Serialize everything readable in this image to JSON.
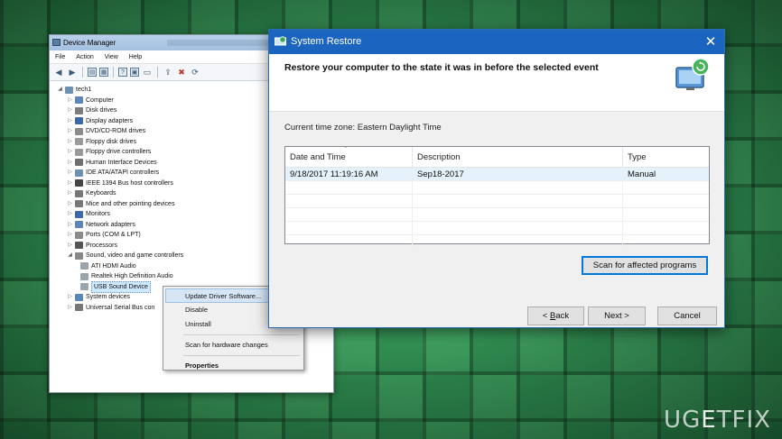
{
  "device_manager": {
    "title": "Device Manager",
    "menu": [
      "File",
      "Action",
      "View",
      "Help"
    ],
    "tree": {
      "root": "tech1",
      "categories": [
        {
          "label": "Computer",
          "expanded": false,
          "color": "#5b86b8"
        },
        {
          "label": "Disk drives",
          "expanded": false,
          "color": "#7d7d7d"
        },
        {
          "label": "Display adapters",
          "expanded": false,
          "color": "#3d6aa6"
        },
        {
          "label": "DVD/CD-ROM drives",
          "expanded": false,
          "color": "#8b8b8b"
        },
        {
          "label": "Floppy disk drives",
          "expanded": false,
          "color": "#9a9a9a"
        },
        {
          "label": "Floppy drive controllers",
          "expanded": false,
          "color": "#9a9a9a"
        },
        {
          "label": "Human Interface Devices",
          "expanded": false,
          "color": "#6f6f6f"
        },
        {
          "label": "IDE ATA/ATAPI controllers",
          "expanded": false,
          "color": "#6f8fb0"
        },
        {
          "label": "IEEE 1394 Bus host controllers",
          "expanded": false,
          "color": "#444"
        },
        {
          "label": "Keyboards",
          "expanded": false,
          "color": "#777"
        },
        {
          "label": "Mice and other pointing devices",
          "expanded": false,
          "color": "#777"
        },
        {
          "label": "Monitors",
          "expanded": false,
          "color": "#3d6aa6"
        },
        {
          "label": "Network adapters",
          "expanded": false,
          "color": "#5b86b8"
        },
        {
          "label": "Ports (COM & LPT)",
          "expanded": false,
          "color": "#8a8a8a"
        },
        {
          "label": "Processors",
          "expanded": false,
          "color": "#555"
        },
        {
          "label": "Sound, video and game controllers",
          "expanded": true,
          "color": "#888",
          "children": [
            "ATI HDMI Audio",
            "Realtek High Definition Audio",
            "USB Sound Device"
          ]
        },
        {
          "label": "System devices",
          "expanded": false,
          "color": "#5b86b8"
        },
        {
          "label": "Universal Serial Bus con",
          "expanded": false,
          "color": "#777"
        }
      ]
    },
    "context_menu": {
      "items": [
        "Update Driver Software...",
        "Disable",
        "Uninstall"
      ],
      "scan": "Scan for hardware changes",
      "properties": "Properties"
    }
  },
  "system_restore": {
    "title": "System Restore",
    "close": "✕",
    "heading": "Restore your computer to the state it was in before the selected event",
    "timezone": "Current time zone: Eastern Daylight Time",
    "columns": [
      "Date and Time",
      "Description",
      "Type"
    ],
    "rows": [
      {
        "date": "9/18/2017 11:19:16 AM",
        "description": "Sep18-2017",
        "type": "Manual"
      }
    ],
    "buttons": {
      "scan": "Scan for affected programs",
      "back_lt": "< ",
      "back_key": "B",
      "back_rest": "ack",
      "next": "Next >",
      "cancel": "Cancel"
    }
  },
  "watermark": {
    "left": "UG",
    "accent": "E",
    "right": "TFIX"
  }
}
